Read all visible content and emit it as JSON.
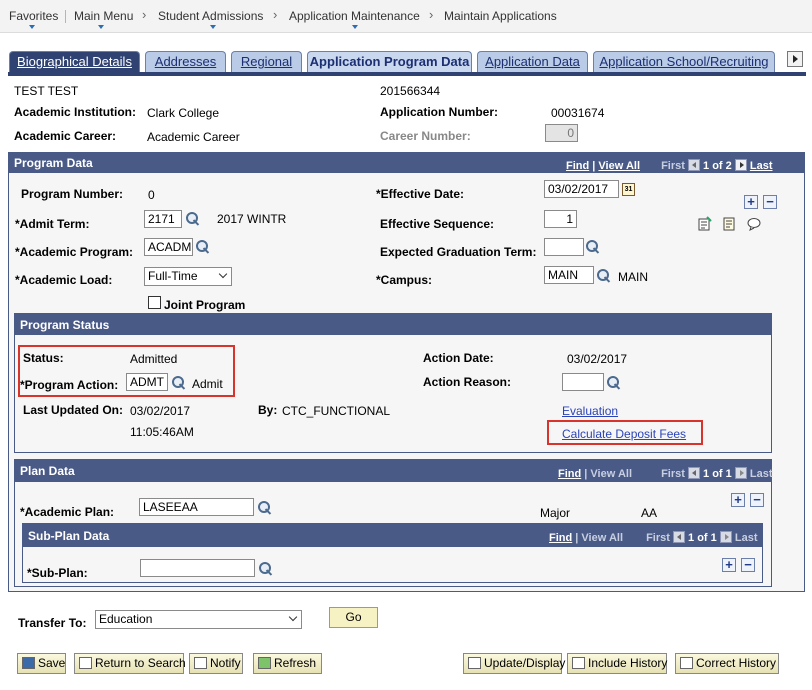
{
  "topnav": {
    "favorites": "Favorites",
    "main_menu": "Main Menu",
    "crumb1": "Student Admissions",
    "crumb2": "Application Maintenance",
    "crumb3": "Maintain Applications"
  },
  "tabs": [
    {
      "label": "Biographical Details",
      "active": true
    },
    {
      "label": "Addresses"
    },
    {
      "label": "Regional"
    },
    {
      "label": "Application Program Data",
      "current": true
    },
    {
      "label": "Application Data"
    },
    {
      "label": "Application School/Recruiting"
    }
  ],
  "header": {
    "name": "TEST TEST",
    "id": "201566344",
    "institution_label": "Academic Institution:",
    "institution_value": "Clark College",
    "app_number_label": "Application Number:",
    "app_number_value": "00031674",
    "career_label": "Academic Career:",
    "career_value": "Academic Career",
    "career_number_label": "Career Number:",
    "career_number_value": "0"
  },
  "program_data": {
    "title": "Program Data",
    "find": "Find",
    "view_all": "View All",
    "first": "First",
    "count": "1 of 2",
    "last": "Last",
    "program_number_label": "Program Number:",
    "program_number_value": "0",
    "effective_date_label": "*Effective Date:",
    "effective_date_value": "03/02/2017",
    "admit_term_label": "*Admit Term:",
    "admit_term_value": "2171",
    "admit_term_desc": "2017 WINTR",
    "effective_sequence_label": "Effective Sequence:",
    "effective_sequence_value": "1",
    "academic_program_label": "*Academic Program:",
    "academic_program_value": "ACADM",
    "expected_grad_label": "Expected Graduation Term:",
    "expected_grad_value": "",
    "academic_load_label": "*Academic Load:",
    "academic_load_value": "Full-Time",
    "campus_label": "*Campus:",
    "campus_value": "MAIN",
    "campus_desc": "MAIN",
    "joint_program_label": "Joint Program",
    "calendar_icon_text": "31"
  },
  "program_status": {
    "title": "Program Status",
    "status_label": "Status:",
    "status_value": "Admitted",
    "program_action_label": "*Program Action:",
    "program_action_value": "ADMT",
    "program_action_desc": "Admit",
    "action_date_label": "Action Date:",
    "action_date_value": "03/02/2017",
    "action_reason_label": "Action Reason:",
    "action_reason_value": "",
    "last_updated_label": "Last Updated On:",
    "last_updated_date": "03/02/2017",
    "last_updated_time": "11:05:46AM",
    "by_label": "By:",
    "by_value": "CTC_FUNCTIONAL",
    "evaluation_link": "Evaluation",
    "deposit_link": "Calculate Deposit Fees"
  },
  "plan_data": {
    "title": "Plan Data",
    "find": "Find",
    "view_all": "View All",
    "first": "First",
    "count": "1 of 1",
    "last": "Last",
    "academic_plan_label": "*Academic Plan:",
    "academic_plan_value": "LASEEAA",
    "plan_type": "Major",
    "plan_degree": "AA"
  },
  "sub_plan_data": {
    "title": "Sub-Plan Data",
    "find": "Find",
    "view_all": "View All",
    "first": "First",
    "count": "1 of 1",
    "last": "Last",
    "sub_plan_label": "*Sub-Plan:",
    "sub_plan_value": ""
  },
  "transfer": {
    "label": "Transfer To:",
    "value": "Education",
    "go": "Go"
  },
  "toolbar": {
    "save": "Save",
    "return_to_search": "Return to Search",
    "notify": "Notify",
    "refresh": "Refresh",
    "update_display": "Update/Display",
    "include_history": "Include History",
    "correct_history": "Correct History"
  },
  "colors": {
    "group_header": "#4a5a86",
    "tab_active": "#2f4271",
    "tab_inactive": "#b9cbe6",
    "highlight_box": "#d9342b",
    "link": "#2a43b7"
  }
}
